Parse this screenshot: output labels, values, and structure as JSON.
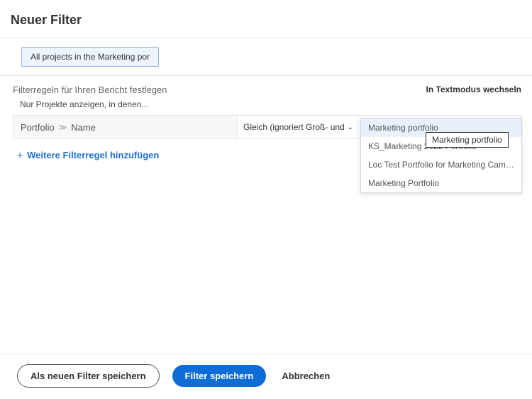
{
  "header": {
    "title": "Neuer Filter"
  },
  "topbar": {
    "project_pill": "All projects in the Marketing  por"
  },
  "filter": {
    "rules_label": "Filterregeln für Ihren Bericht festlegen",
    "sub_label": "Nur Projekte anzeigen, in denen...",
    "textmode_link": "In Textmodus wechseln",
    "field_parent": "Portfolio",
    "field_child": "Name",
    "operator": "Gleich (ignoriert Groß- und Kleinschreibung)",
    "value_input": "Marketing  portfolio",
    "add_rule": "Weitere Filterregel hinzufügen"
  },
  "dropdown": {
    "options": [
      "Marketing portfolio",
      "KS_Marketing 2022 Portfolio",
      "Loc Test Portfolio for Marketing Campaign",
      "Marketing Portfolio"
    ]
  },
  "tooltip": {
    "text": "Marketing portfolio"
  },
  "footer": {
    "save_as_new": "Als neuen Filter speichern",
    "save": "Filter speichern",
    "cancel": "Abbrechen"
  }
}
